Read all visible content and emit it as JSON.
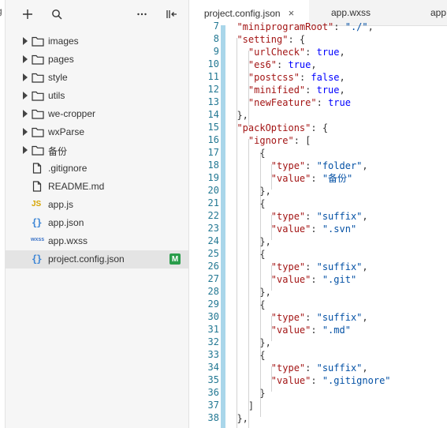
{
  "tabs": [
    {
      "label": "project.config.json",
      "active": true,
      "close": "×"
    },
    {
      "label": "app.wxss",
      "active": false
    },
    {
      "label": "app",
      "active": false
    }
  ],
  "explorer": {
    "toolbar": {
      "add": "+",
      "search": "search-icon",
      "more": "···",
      "collapse": "collapse-icon"
    },
    "items": [
      {
        "name": "images",
        "kind": "folder"
      },
      {
        "name": "pages",
        "kind": "folder"
      },
      {
        "name": "style",
        "kind": "folder"
      },
      {
        "name": "utils",
        "kind": "folder"
      },
      {
        "name": "we-cropper",
        "kind": "folder"
      },
      {
        "name": "wxParse",
        "kind": "folder"
      },
      {
        "name": "备份",
        "kind": "folder"
      },
      {
        "name": ".gitignore",
        "kind": "file"
      },
      {
        "name": "README.md",
        "kind": "file"
      },
      {
        "name": "app.js",
        "kind": "js",
        "icon_label": "JS"
      },
      {
        "name": "app.json",
        "kind": "json",
        "icon_label": "{}"
      },
      {
        "name": "app.wxss",
        "kind": "wxss",
        "icon_label": "wxss"
      },
      {
        "name": "project.config.json",
        "kind": "json",
        "icon_label": "{}",
        "selected": true,
        "badge": "M"
      }
    ]
  },
  "editor": {
    "line_numbers": [
      "7",
      "8",
      "9",
      "10",
      "11",
      "12",
      "13",
      "14",
      "15",
      "16",
      "17",
      "18",
      "19",
      "20",
      "21",
      "22",
      "23",
      "24",
      "25",
      "26",
      "27",
      "28",
      "29",
      "30",
      "31",
      "32",
      "33",
      "34",
      "35",
      "36",
      "37",
      "38"
    ],
    "lines": [
      "  \"miniprogramRoot\": \"./\",",
      "  \"setting\": {",
      "    \"urlCheck\": true,",
      "    \"es6\": true,",
      "    \"postcss\": false,",
      "    \"minified\": true,",
      "    \"newFeature\": true",
      "  },",
      "  \"packOptions\": {",
      "    \"ignore\": [",
      "      {",
      "        \"type\": \"folder\",",
      "        \"value\": \"备份\"",
      "      },",
      "      {",
      "        \"type\": \"suffix\",",
      "        \"value\": \".svn\"",
      "      },",
      "      {",
      "        \"type\": \"suffix\",",
      "        \"value\": \".git\"",
      "      },",
      "      {",
      "        \"type\": \"suffix\",",
      "        \"value\": \".md\"",
      "      },",
      "      {",
      "        \"type\": \"suffix\",",
      "        \"value\": \".gitignore\"",
      "      }",
      "    ]",
      "  },"
    ]
  },
  "colors": {
    "key": "#a31515",
    "string": "#0451a5",
    "keyword": "#0000ff",
    "line_number": "#237893",
    "badge": "#2a9d4b"
  }
}
